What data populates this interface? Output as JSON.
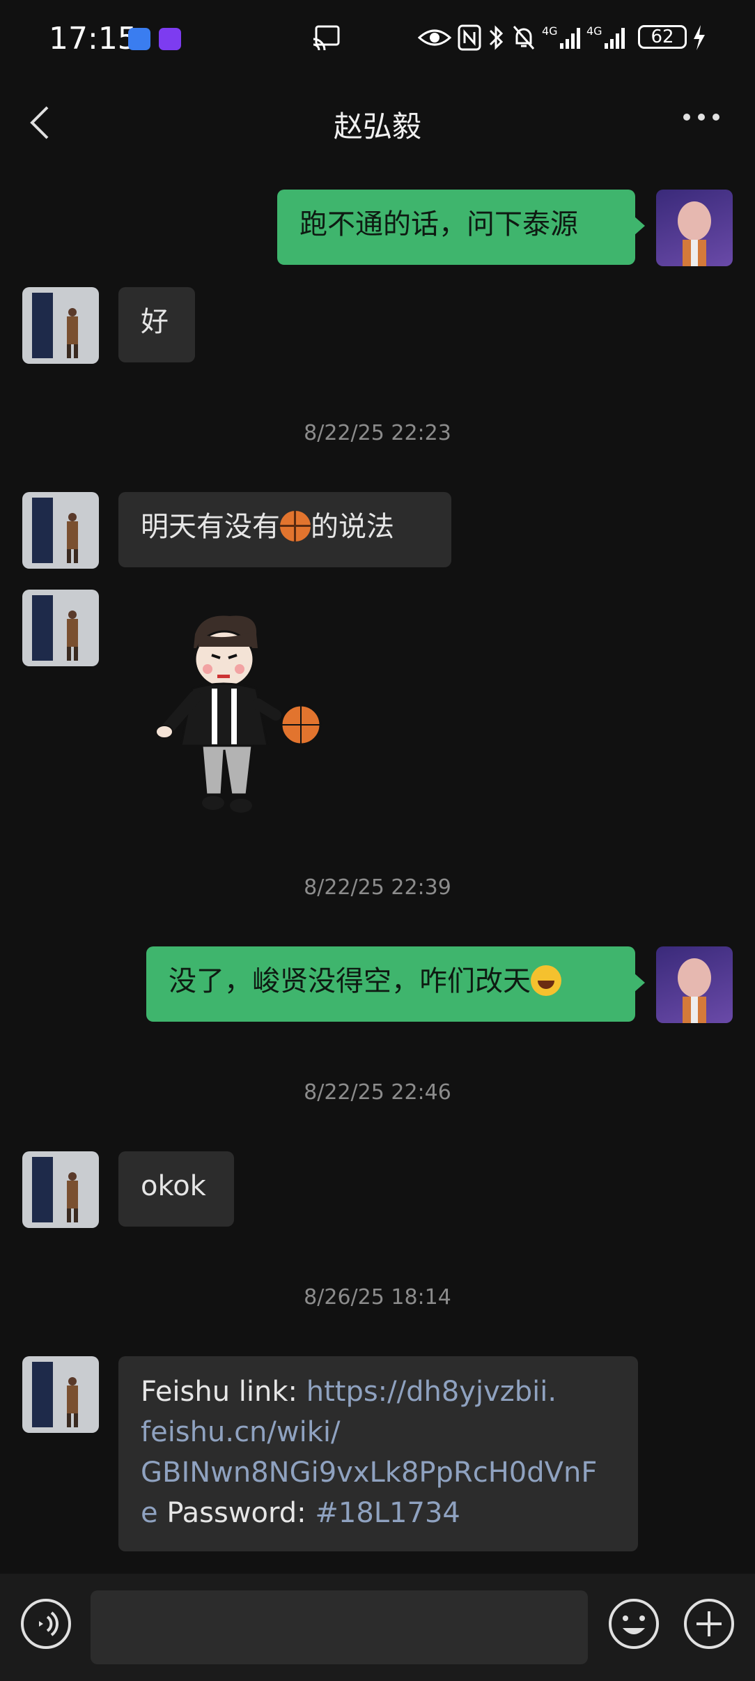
{
  "status_bar": {
    "time": "17:15",
    "battery": "62",
    "icons": [
      "usb-icon",
      "app-badge-icon",
      "cast-icon",
      "eye-icon",
      "nfc-icon",
      "bluetooth-icon",
      "mute-icon",
      "signal-4g-icon",
      "signal-4g-icon",
      "battery-icon",
      "charging-icon"
    ]
  },
  "header": {
    "title": "赵弘毅"
  },
  "messages": [
    {
      "side": "out",
      "text": "跑不通的话，问下泰源"
    },
    {
      "side": "in",
      "text": "好"
    },
    {
      "timestamp": "8/22/25 22:23"
    },
    {
      "side": "in",
      "text_before": "明天有没有",
      "text_after": "的说法",
      "emoji": "basketball"
    },
    {
      "side": "in",
      "sticker": "boy-dribbling-basketball-sticker"
    },
    {
      "timestamp": "8/22/25 22:39"
    },
    {
      "side": "out",
      "text": "没了，峻贤没得空，咋们改天",
      "emoji": "laughing-tears"
    },
    {
      "timestamp": "8/22/25 22:46"
    },
    {
      "side": "in",
      "text": "okok"
    },
    {
      "timestamp": "8/26/25 18:14"
    },
    {
      "side": "in",
      "lines": [
        {
          "plain": "Feishu link: ",
          "link": "https://dh8yjvzbii."
        },
        {
          "plain": "",
          "link": "feishu.cn/wiki/"
        },
        {
          "plain": "",
          "link": "GBINwn8NGi9vxLk8PpRcH0dVnF"
        },
        {
          "plain": "",
          "link": "e",
          "plain2": " Password: ",
          "link2": "#18L1734"
        }
      ]
    }
  ],
  "input_bar": {
    "placeholder": "",
    "icons": [
      "voice-icon",
      "emoji-icon",
      "plus-icon"
    ]
  },
  "colors": {
    "background": "#111111",
    "outgoing_bubble": "#3fb56d",
    "incoming_bubble": "#2c2c2c",
    "link": "#8fa2c0"
  }
}
